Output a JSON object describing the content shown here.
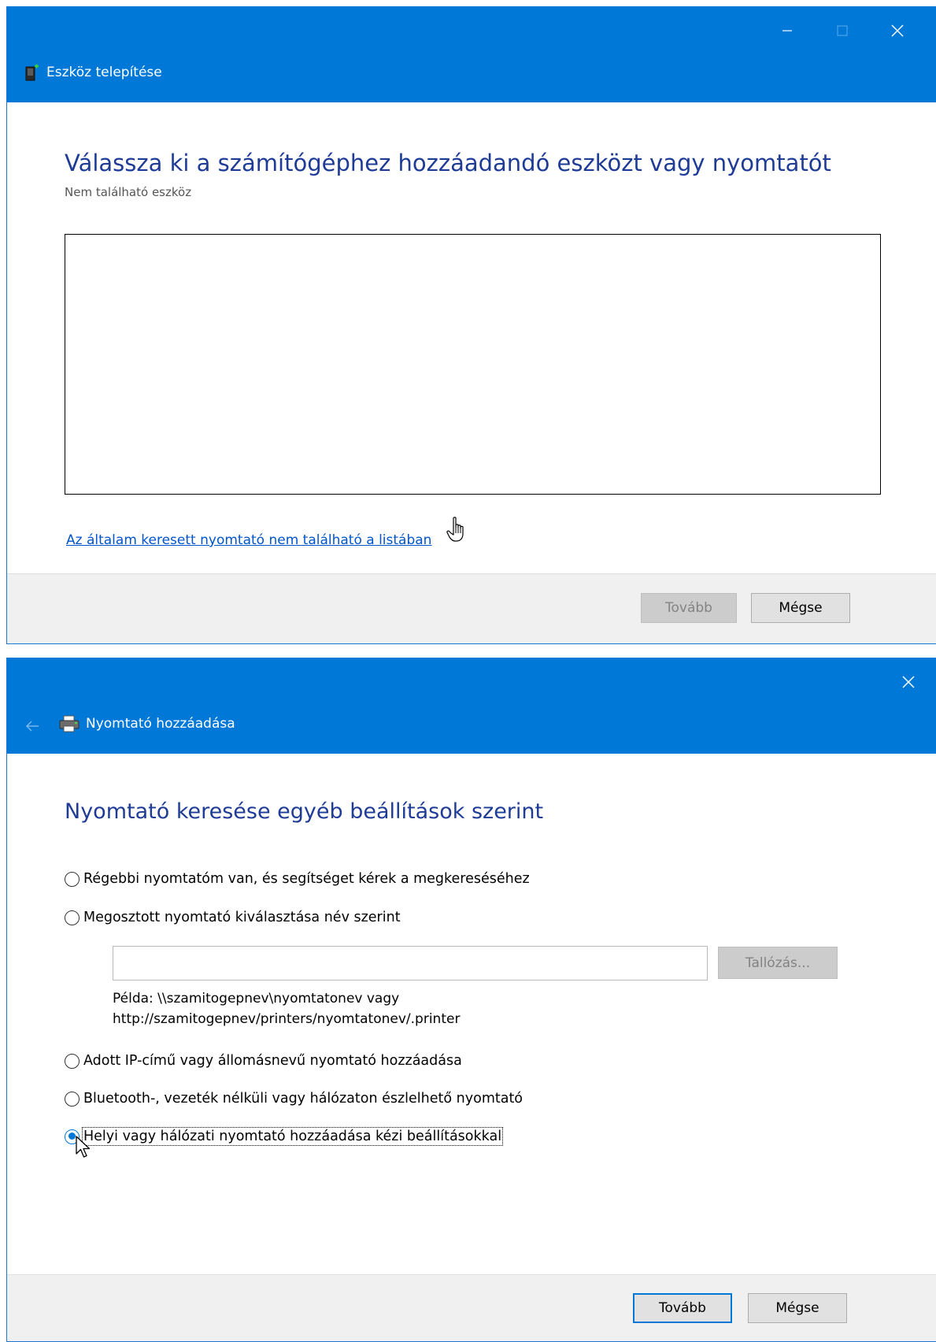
{
  "window1": {
    "title": "Eszköz telepítése",
    "heading": "Válassza ki a számítógéphez hozzáadandó eszközt vagy nyomtatót",
    "subtitle": "Nem található eszköz",
    "link": "Az általam keresett nyomtató nem található a listában",
    "next_label": "Tovább",
    "cancel_label": "Mégse",
    "icons": {
      "app": "device-setup-icon",
      "minimize": "minimize-icon",
      "maximize": "maximize-icon",
      "close": "close-icon",
      "cursor": "hand-pointer-icon"
    }
  },
  "window2": {
    "title": "Nyomtató hozzáadása",
    "heading": "Nyomtató keresése egyéb beállítások szerint",
    "options": [
      {
        "label": "Régebbi nyomtatóm van, és segítséget kérek a megkereséséhez",
        "selected": false
      },
      {
        "label": "Megosztott nyomtató kiválasztása név szerint",
        "selected": false
      },
      {
        "label": "Adott IP-című vagy állomásnevű nyomtató hozzáadása",
        "selected": false
      },
      {
        "label": "Bluetooth-, vezeték nélküli vagy hálózaton észlelhető nyomtató",
        "selected": false
      },
      {
        "label": "Helyi vagy hálózati nyomtató hozzáadása kézi beállításokkal",
        "selected": true
      }
    ],
    "shared_printer_input": {
      "value": "",
      "placeholder": ""
    },
    "browse_label": "Tallózás...",
    "example_line1": "Példa: \\\\szamitogepnev\\nyomtatonev vagy",
    "example_line2": "http://szamitogepnev/printers/nyomtatonev/.printer",
    "next_label": "Tovább",
    "cancel_label": "Mégse",
    "icons": {
      "back": "back-arrow-icon",
      "app": "printer-icon",
      "close": "close-icon",
      "cursor": "arrow-pointer-icon"
    }
  },
  "colors": {
    "titlebar": "#0078d7",
    "heading": "#1e3c96",
    "link": "#0055cc",
    "footer": "#f0f0f0"
  }
}
